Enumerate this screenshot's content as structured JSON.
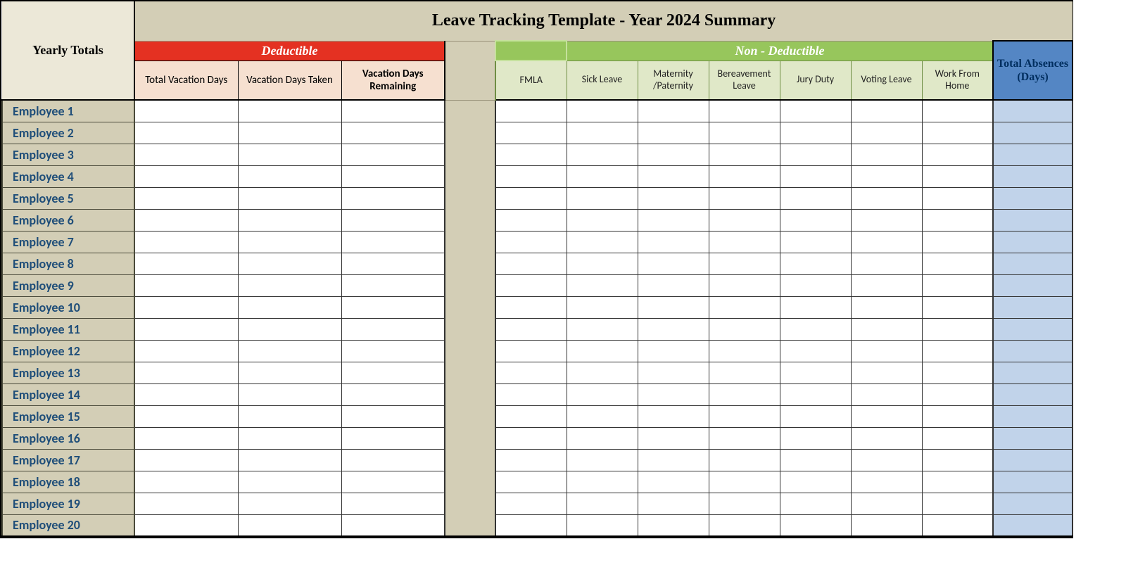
{
  "title": "Leave Tracking Template - Year 2024 Summary",
  "yearly_totals_label": "Yearly Totals",
  "deductible_label": "Deductible",
  "nondeductible_label": "Non - Deductible",
  "total_absences_label": "Total Absences (Days)",
  "deductible_cols": [
    "Total Vacation Days",
    "Vacation Days Taken",
    "Vacation Days Remaining"
  ],
  "nondeductible_cols": [
    "FMLA",
    "Sick Leave",
    "Maternity /Paternity",
    "Bereavement Leave",
    "Jury Duty",
    "Voting Leave",
    "Work From Home"
  ],
  "employees": [
    "Employee 1",
    "Employee 2",
    "Employee 3",
    "Employee 4",
    "Employee 5",
    "Employee 6",
    "Employee 7",
    "Employee 8",
    "Employee 9",
    "Employee 10",
    "Employee 11",
    "Employee 12",
    "Employee 13",
    "Employee 14",
    "Employee 15",
    "Employee 16",
    "Employee 17",
    "Employee 18",
    "Employee 19",
    "Employee 20"
  ]
}
